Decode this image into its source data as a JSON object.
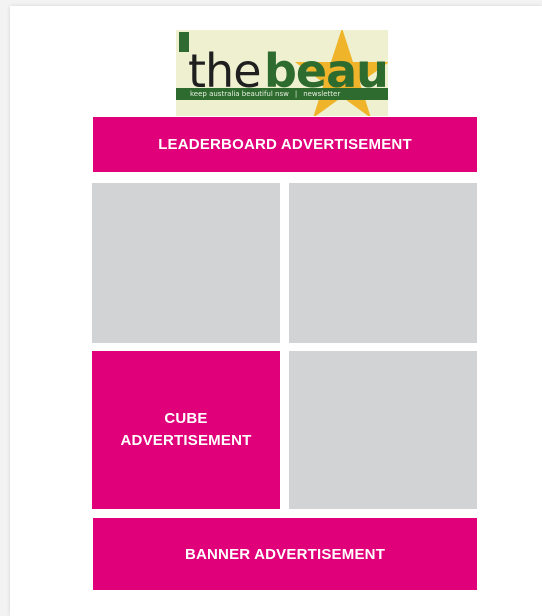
{
  "logo": {
    "word_the": "the",
    "word_beaut": "beaut'",
    "tagline_left": "keep australia beautiful nsw",
    "tagline_right": "newsletter"
  },
  "ads": {
    "leaderboard": "LEADERBOARD ADVERTISEMENT",
    "cube_line1": "CUBE",
    "cube_line2": "ADVERTISEMENT",
    "banner": "BANNER ADVERTISEMENT"
  },
  "colors": {
    "ad_pink": "#e0007a",
    "placeholder_gray": "#d2d3d5",
    "logo_green": "#2e6b2f",
    "logo_star": "#f0b42a"
  }
}
